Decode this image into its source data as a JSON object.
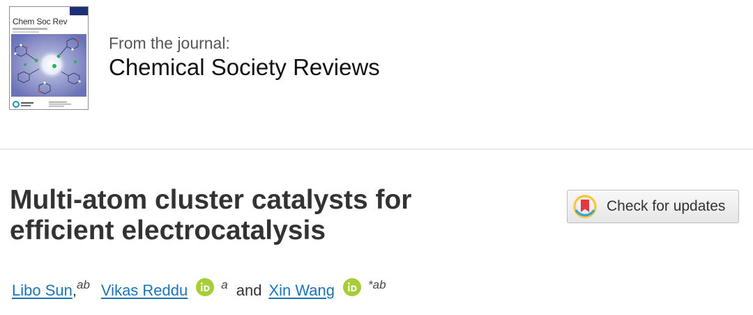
{
  "journal": {
    "cover_title": "Chem Soc Rev",
    "from_label": "From the journal:",
    "name": "Chemical Society Reviews"
  },
  "article": {
    "title": "Multi-atom cluster catalysts for efficient electrocatalysis",
    "check_updates_label": "Check for updates",
    "authors": [
      {
        "name": "Libo Sun",
        "affiliation": "ab",
        "separator": ",",
        "orcid": false
      },
      {
        "name": "Vikas Reddu",
        "affiliation": "a",
        "separator": "",
        "orcid": true
      },
      {
        "name": "Xin Wang",
        "affiliation": "*ab",
        "separator": "",
        "orcid": true
      }
    ],
    "and_word": "and"
  },
  "colors": {
    "link": "#1a73b8",
    "orcid_green": "#a6ce39",
    "title_text": "#333333",
    "cover_navy": "#1e2f76",
    "crossmark_red": "#e0393e",
    "crossmark_yellow": "#f7c93e",
    "crossmark_teal": "#3aa6c9"
  },
  "icons": {
    "orcid": "orcid-icon",
    "crossmark": "crossmark-icon"
  }
}
